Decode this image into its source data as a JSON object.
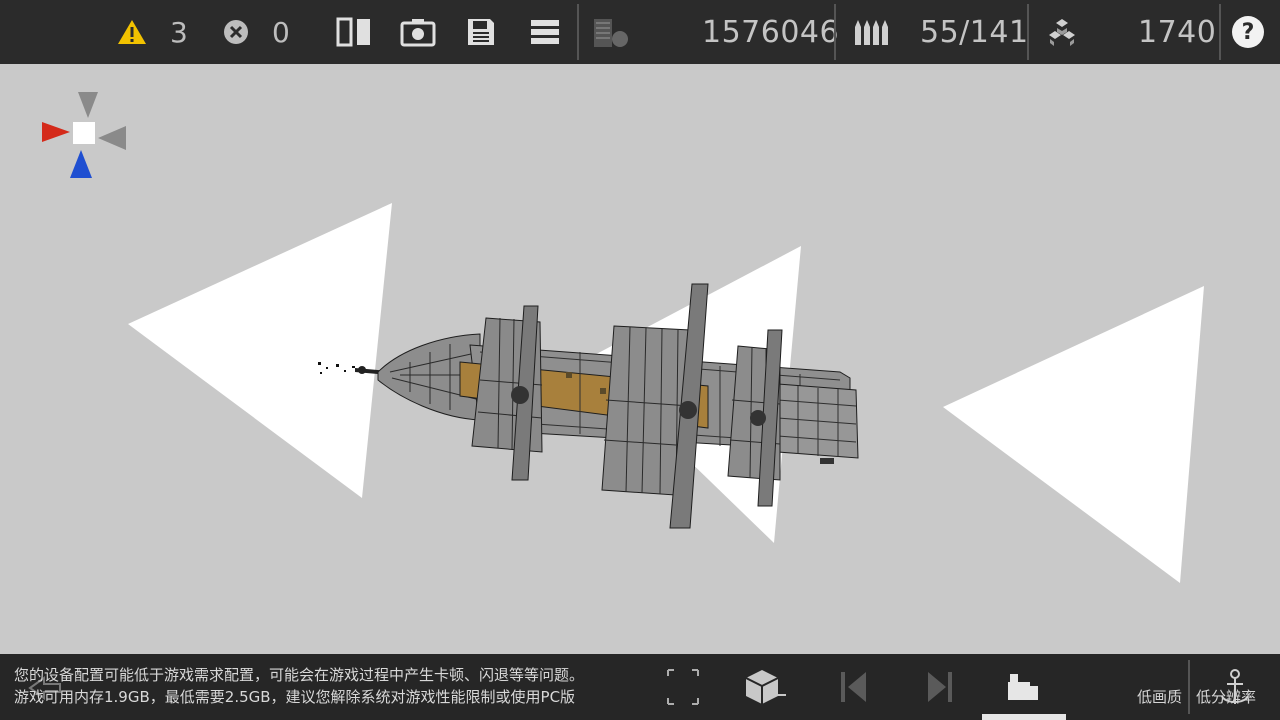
{
  "topbar": {
    "warnings_count": "3",
    "errors_count": "0",
    "block_count": "1576046",
    "ammo": "55/141",
    "mass": "1740",
    "help_label": "?"
  },
  "bottombar": {
    "notice_line1": "您的设备配置可能低于游戏需求配置，可能会在游戏过程中产生卡顿、闪退等等问题。",
    "notice_line2": "游戏可用内存1.9GB，最低需要2.5GB，建议您解除系统对游戏性能限制或使用PC版",
    "low_quality_label": "低画质",
    "low_resolution_label": "低分辨率"
  },
  "colors": {
    "bar_bg": "#2b2b2b",
    "viewport_bg": "#c9c9c9",
    "warning_yellow": "#f2c200",
    "axis_red": "#d42a1a",
    "axis_blue": "#1f4fd1",
    "deck_brown": "#a8803c"
  }
}
